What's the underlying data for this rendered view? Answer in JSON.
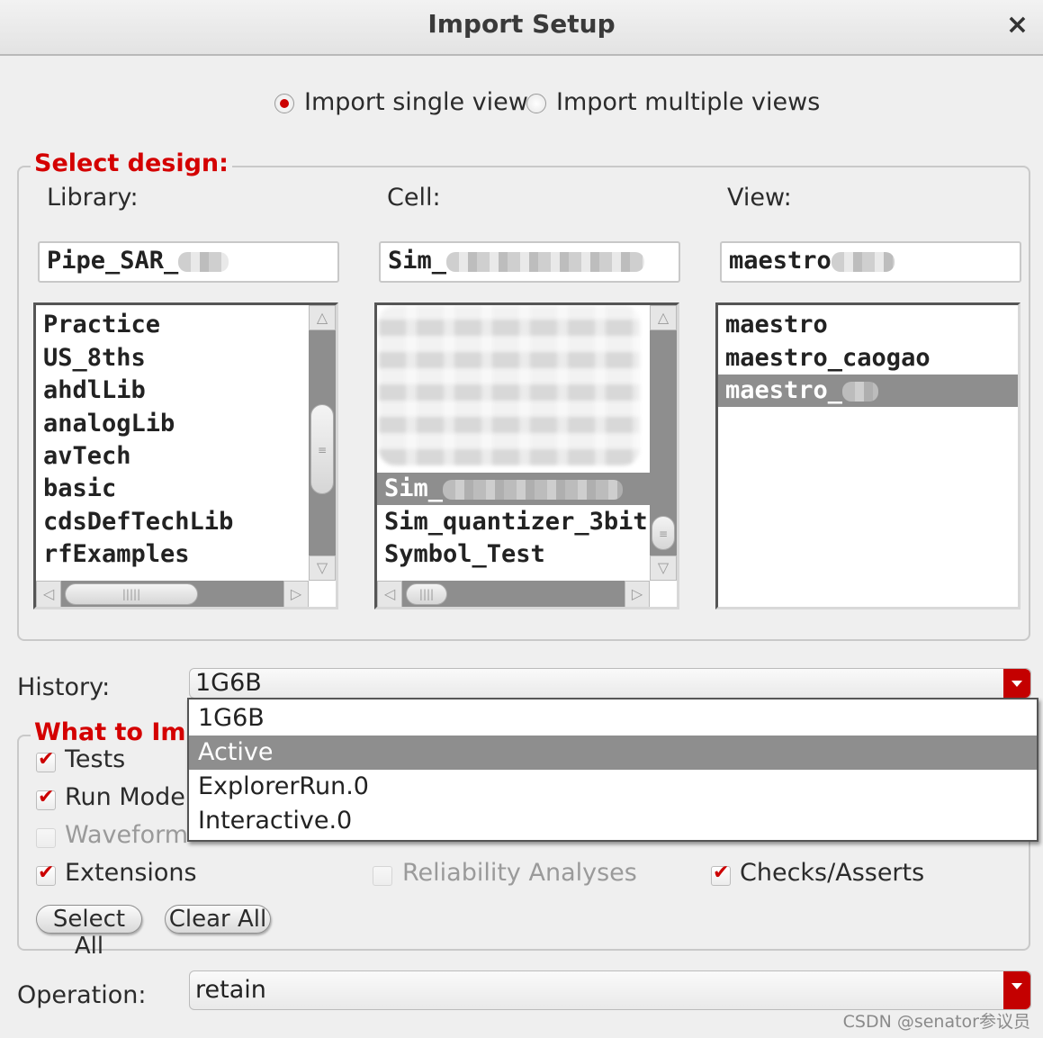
{
  "window": {
    "title": "Import Setup",
    "close_label": "×"
  },
  "mode": {
    "single_label": "Import single view",
    "multiple_label": "Import multiple views",
    "selected": "single"
  },
  "select_design": {
    "title": "Select design:",
    "library": {
      "label": "Library:",
      "value": "Pipe_SAR_",
      "items": [
        "Practice",
        "US_8ths",
        "ahdlLib",
        "analogLib",
        "avTech",
        "basic",
        "cdsDefTechLib",
        "rfExamples"
      ]
    },
    "cell": {
      "label": "Cell:",
      "value": "Sim_",
      "items": [
        "Sim_",
        "Sim_quantizer_3bit",
        "Symbol_Test"
      ],
      "selected": "Sim_"
    },
    "view": {
      "label": "View:",
      "value": "maestro",
      "items": [
        "maestro",
        "maestro_caogao",
        "maestro_"
      ],
      "selected": "maestro_"
    }
  },
  "history": {
    "label": "History:",
    "value": "1G6B",
    "options": [
      "1G6B",
      "Active",
      "ExplorerRun.0",
      "Interactive.0"
    ],
    "highlighted": "Active"
  },
  "what_to_import": {
    "title": "What to Imp",
    "items": [
      {
        "label": "Tests",
        "checked": true,
        "enabled": true
      },
      {
        "label": "Run Mode",
        "checked": true,
        "enabled": true
      },
      {
        "label": "Waveform",
        "checked": false,
        "enabled": false
      },
      {
        "label": "Extensions",
        "checked": true,
        "enabled": true
      },
      {
        "label": "Reliability Analyses",
        "checked": false,
        "enabled": false
      },
      {
        "label": "Checks/Asserts",
        "checked": true,
        "enabled": true
      }
    ],
    "select_all_label": "Select All",
    "clear_all_label": "Clear All"
  },
  "operation": {
    "label": "Operation:",
    "value": "retain"
  },
  "watermark": "CSDN @senator参议员",
  "colors": {
    "accent": "#cc0000",
    "selection": "#8e8e8e"
  }
}
